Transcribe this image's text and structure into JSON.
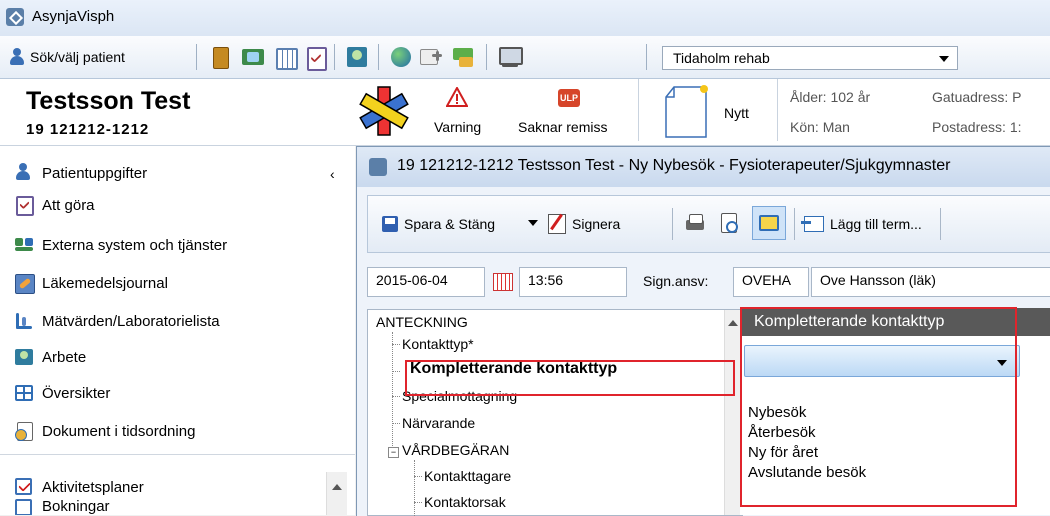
{
  "window": {
    "title": "AsynjaVisph"
  },
  "toolbar": {
    "search_label": "Sök/välj patient",
    "unit_value": "Tidaholm rehab"
  },
  "patient": {
    "name": "Testsson Test",
    "id": "19 121212-1212",
    "warning_label": "Varning",
    "referral_label": "Saknar remiss",
    "ulp_badge": "ULP",
    "new_label": "Nytt",
    "age_label": "Ålder: 102 år",
    "gender_label": "Kön: Man",
    "street_label": "Gatuadress: P",
    "postal_label": "Postadress: 1:"
  },
  "nav": {
    "items": [
      {
        "label": "Patientuppgifter",
        "icon": "patient-icon"
      },
      {
        "label": "Att göra",
        "icon": "todo-icon"
      },
      {
        "label": "Externa system och tjänster",
        "icon": "external-systems-icon"
      },
      {
        "label": "Läkemedelsjournal",
        "icon": "medication-icon"
      },
      {
        "label": "Mätvärden/Laboratorielista",
        "icon": "lab-icon"
      },
      {
        "label": "Arbete",
        "icon": "work-icon"
      },
      {
        "label": "Översikter",
        "icon": "overview-icon"
      },
      {
        "label": "Dokument i tidsordning",
        "icon": "documents-icon"
      }
    ],
    "bottom_items": [
      {
        "label": "Aktivitetsplaner",
        "icon": "activity-plan-icon"
      },
      {
        "label": "Bokningar",
        "icon": "booking-icon"
      }
    ]
  },
  "dialog": {
    "title": "19 121212-1212 Testsson Test - Ny Nybesök - Fysioterapeuter/Sjukgymnaster",
    "save_close_label": "Spara & Stäng",
    "sign_label": "Signera",
    "add_term_label": "Lägg till term...",
    "date_value": "2015-06-04",
    "time_value": "13:56",
    "sign_resp_label": "Sign.ansv:",
    "sign_code": "OVEHA",
    "sign_name": "Ove Hansson (läk)"
  },
  "tree": {
    "root": "ANTECKNING",
    "items": [
      "Kontakttyp*",
      "Kompletterande kontakttyp",
      "Specialmottagning",
      "Närvarande"
    ],
    "group": "VÅRDBEGÄRAN",
    "group_items": [
      "Kontakttagare",
      "Kontaktorsak"
    ]
  },
  "panel": {
    "heading": "Kompletterande kontakttyp",
    "options": [
      "Nybesök",
      "Återbesök",
      "Ny för året",
      "Avslutande besök"
    ]
  },
  "colors": {
    "highlight_box": "#e0242c",
    "panel_header": "#595959"
  }
}
